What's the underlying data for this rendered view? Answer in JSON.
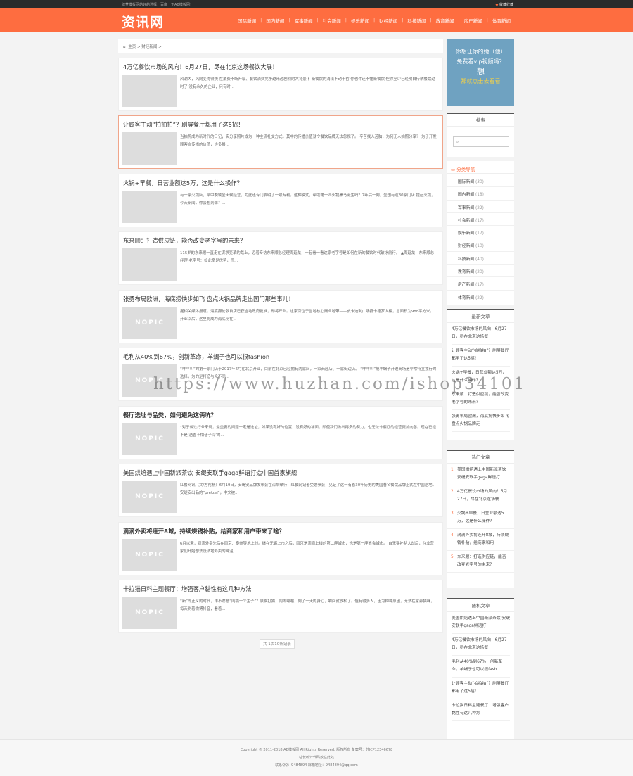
{
  "topbar": {
    "left": "织梦模板网站好的选择，百度一下AB模板网！",
    "right": "收藏收藏"
  },
  "logo": "资讯网",
  "nav": [
    "国际新闻",
    "国内新闻",
    "军事新闻",
    "社会新闻",
    "娱乐新闻",
    "财经新闻",
    "科技新闻",
    "教育新闻",
    "房产新闻",
    "体育新闻"
  ],
  "breadcrumb": {
    "home": "主页",
    "sep": ">",
    "current": "财经新闻",
    "tail": ">"
  },
  "articles": [
    {
      "title": "4万亿餐饮市场的风向！6月27日，尽在北京这场餐饮大展！",
      "desc": "风潮大，风向变得很快 在消费不断升级、餐饮消费竞争越来越剧烈的大背景下 新餐饮的消法不动于哲 你也许还不懂新餐饮 但你至少已经明白传统餐饮过时了 没有永久的企业，只有时...",
      "thumb": "photo-red"
    },
    {
      "title": "让顾客主动“拍拍拍”？刷屏餐厅都用了这5招！",
      "desc": "当拍照成为新时代的日记，实分享照片成为一种主流社交方式，其中的传播价值就令餐饮品牌无法忽视了。 辛苦找入苦脑，为何无人拍照分享？ 为了开发顾客自传播的价值，许多餐...",
      "thumb": "photo-green"
    },
    {
      "title": "火锅+早餐，日营业额达5万，这是什么操作？",
      "desc": "有一家火锅店，早中晚餐全天候经营，为此还专门发明了一项专利。这种模式，帮助第一匹火锅黑马诞生吗？7年后一倒，全国有近30家门店 提起火锅，今天新闻，你会想到谁？...",
      "thumb": "photo-soup"
    },
    {
      "title": "东来顺：打造供应链，能否改变老字号的未来？",
      "desc": "115岁的东来顺一直走在谋求变革的路上，迈着专访东来顺总经理周延龙，一起看一看这家老字号是如何在新的餐饮时代破冰前行。 ▲周延龙—东来顺总经理 老字号：如此童是优势，符...",
      "thumb": "photo-night"
    },
    {
      "title": "张勇布局欧洲，海底捞快步如飞 盘点火锅品牌走出国门那些事儿！",
      "desc": "据相关媒体报道，海底捞伦敦首店已获当地政府批准，即将开业。这家店位于当地核心商业地带——皮卡迪利广场投卡德罗大楼，总面积为988平方米。开业以后，这里将成为海底捞在...",
      "thumb": "NOPIC"
    },
    {
      "title": "毛利从40%到67%，创新革命，羊蝎子也可以很fashion",
      "desc": "“咩咩叫”的第一家门店于2017年6月在北京开业，目前在北京已经拥有两家店，一家商超店、一家街边店。 “咩咩叫”把羊蝎子开进商场是非常特立独行的选择，为的是打造与众不同...",
      "thumb": "NOPIC"
    },
    {
      "title": "餐厅选址与品类，如何避免这俩坑？",
      "desc": "“对于餐饮行业来说，最重要的问题一定是选址，如果没有好的位置，没有好的铺面，即使我们做出再多的努力，也无法令餐厅的经营更加向善。现在已经不是‘酒香不怕巷子深’的...",
      "thumb": "NOPIC",
      "bold": true
    },
    {
      "title": "美国烘焙遇上中国新派茶饮 安缇安联手gaga鲜语打造中国首家旗舰",
      "desc": "红餐网讯（文/方裕杨）6月19日，安缇安品牌发布会在深圳举行，红餐网记者受邀参会，见证了这一有着30年历史的美国著名餐饮品牌正式在中国落地。 安缇安出品的“pretzel”，中文被...",
      "thumb": "NOPIC"
    },
    {
      "title": "滴滴外卖将连开8城，持续烧钱补贴，给商家和用户带来了啥？",
      "desc": "6月以来，滴滴外卖先后在南京、泰州等地上线。继在无锡上市之后，南京是滴滴上线的第二座城市，也是第一座省会城市。 自无锡补贴大战后，在业营家们开始想法设法地外卖的降温...",
      "thumb": "NOPIC",
      "bold": true
    },
    {
      "title": "卡拉猫日料主题餐厅：增强客户黏性有这几种方法",
      "desc": "“新”即正义的时代，谁不愿意“闯横一个主子”？泉猫打猫，闹闹嘤嘤，倒了一天的身心，瞬间就放松了。但有得多人，因为种种原因，无法在家养猫咪，每天刷着微博抖音，看着...",
      "thumb": "NOPIC"
    }
  ],
  "pager": "共 1页10条记录",
  "ad": {
    "line1": "你想让你的她（他）",
    "line2": "免费看vip视频吗？",
    "line3": "想",
    "line4": "那就点击去看看"
  },
  "search": {
    "title": "搜索",
    "placeholder": ""
  },
  "categories": {
    "title": "分类导航",
    "items": [
      {
        "name": "国际新闻",
        "count": "(30)"
      },
      {
        "name": "国内新闻",
        "count": "(18)"
      },
      {
        "name": "军事新闻",
        "count": "(22)"
      },
      {
        "name": "社会新闻",
        "count": "(17)"
      },
      {
        "name": "娱乐新闻",
        "count": "(17)"
      },
      {
        "name": "财经新闻",
        "count": "(10)"
      },
      {
        "name": "科技新闻",
        "count": "(40)"
      },
      {
        "name": "教育新闻",
        "count": "(20)"
      },
      {
        "name": "房产新闻",
        "count": "(17)"
      },
      {
        "name": "体育新闻",
        "count": "(22)"
      }
    ]
  },
  "latest": {
    "title": "最新文章",
    "items": [
      "4万亿餐饮市场的风向！6月27日，尽在北京这场餐",
      "让顾客主动“拍拍拍”？刷屏餐厅都用了这5招！",
      "火锅+早餐，日营业额达5万，这是什么操作？",
      "东来顺：打造供应链，能否改变老字号的未来？",
      "张勇布局欧洲，海底捞快步如飞 盘点火锅品牌走"
    ]
  },
  "hot": {
    "title": "热门文章",
    "items": [
      {
        "num": "1",
        "text": "美国烘焙遇上中国新派茶饮 安缇安联手gaga鲜语打"
      },
      {
        "num": "2",
        "text": "4万亿餐饮市场的风向！6月27日，尽在北京这场餐"
      },
      {
        "num": "3",
        "text": "火锅+早餐，日营业额达5万，这是什么操作？"
      },
      {
        "num": "4",
        "text": "滴滴外卖将连开8城，持续烧钱补贴，给商家和用"
      },
      {
        "num": "5",
        "text": "东来顺：打造供应链，能否改变老字号的未来？"
      }
    ]
  },
  "random": {
    "title": "随机文章",
    "items": [
      "美国烘焙遇上中国新派茶饮 安缇安联手gaga鲜语打",
      "4万亿餐饮市场的风向！6月27日，尽在北京这场餐",
      "毛利从40%到67%，创新革命，羊蝎子也可以很fash",
      "让顾客主动“拍拍拍”？刷屏餐厅都用了这5招！",
      "卡拉猫日料主题餐厅：增强客户黏性有这几种方"
    ]
  },
  "footer": {
    "line1": "Copyright © 2011-2018 AB模板网 All Rights Reserved. 版权所有 备案号：苏ICP12346678",
    "line2": "站长统计代码放在此处",
    "line3": "联系QQ：9484894 邮箱地址：9484894@qq.com"
  },
  "watermark": "https://www.huzhan.com/ishop34101"
}
